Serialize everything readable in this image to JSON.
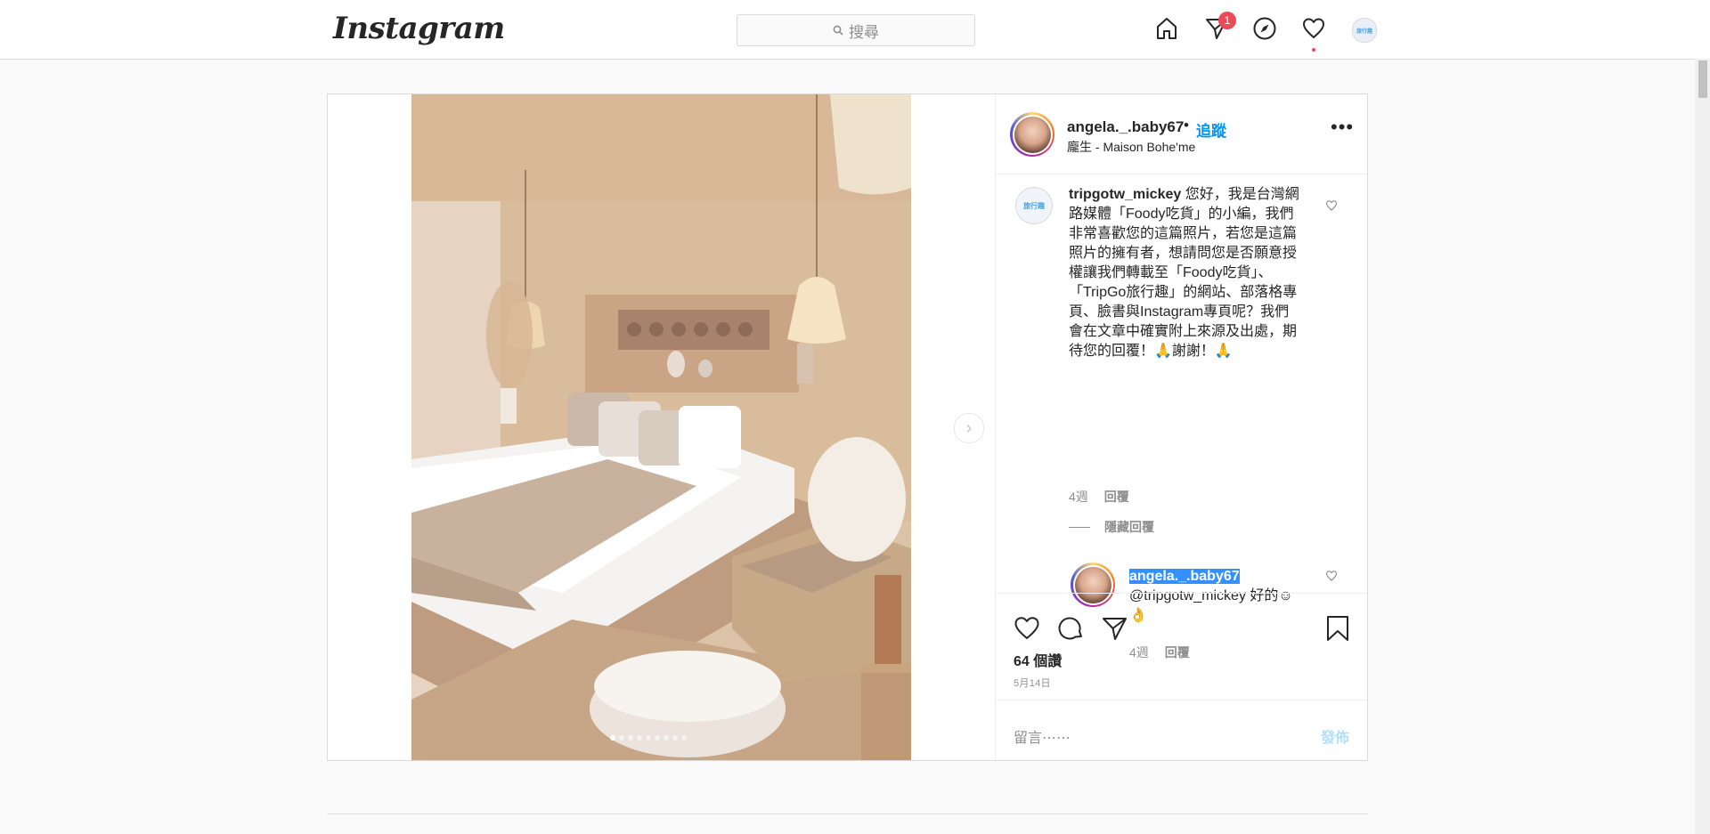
{
  "app": {
    "logo_text": "Instagram"
  },
  "topbar": {
    "search_placeholder": "搜尋",
    "notification_count": "1",
    "avatar_text": "旅行趣"
  },
  "post": {
    "owner": {
      "username": "angela._.baby67",
      "separator": "•",
      "follow_label": "追蹤",
      "location": "龐生 - Maison Bohe'me"
    },
    "more_label": "•••",
    "comments": [
      {
        "avatar_text": "旅行趣",
        "username": "tripgotw_mickey",
        "text": " 您好，我是台灣網路媒體「Foody吃貨」的小編，我們非常喜歡您的這篇照片，若您是這篇照片的擁有者，想請問您是否願意授權讓我們轉載至「Foody吃貨」、「TripGo旅行趣」的網站、部落格專頁、臉書與Instagram專頁呢？我們會在文章中確實附上來源及出處，期待您的回覆！🙏謝謝！🙏",
        "time": "4週",
        "reply_label": "回覆"
      }
    ],
    "hide_replies_label": "隱藏回覆",
    "reply": {
      "username": "angela._.baby67",
      "mention": "@tripgotw_mickey",
      "text": " 好的☺👌",
      "time": "4週",
      "reply_label": "回覆"
    },
    "likes_text": "64 個讚",
    "date_text": "5月14日",
    "comment_placeholder": "留言⋯⋯",
    "post_button": "發佈",
    "carousel": {
      "total": 9,
      "current": 1
    }
  },
  "colors": {
    "accent": "#0095f6",
    "badge": "#ed4956",
    "post_button_disabled": "#b2dffc"
  }
}
